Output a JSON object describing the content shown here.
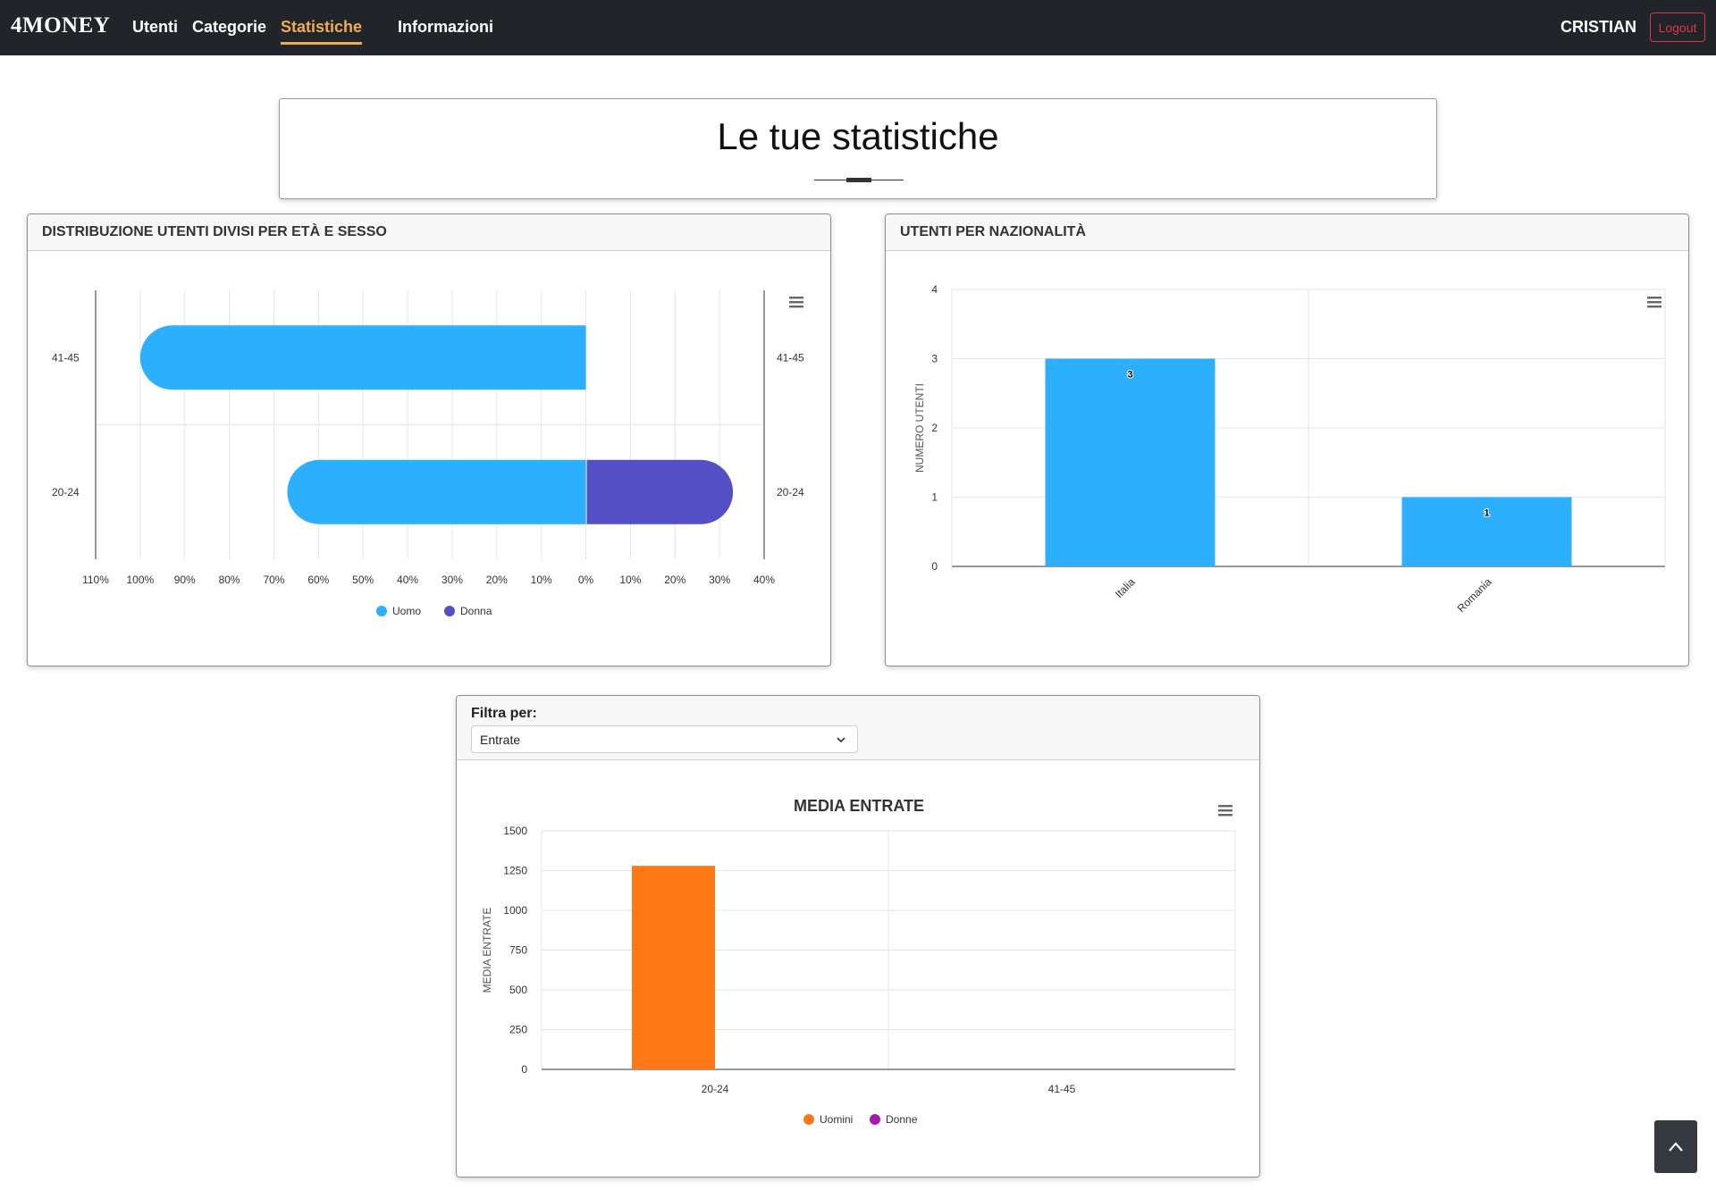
{
  "navbar": {
    "brand": "4MONEY",
    "links": [
      {
        "label": "Utenti",
        "active": false
      },
      {
        "label": "Categorie",
        "active": false
      },
      {
        "label": "Statistiche",
        "active": true
      },
      {
        "label": "Informazioni",
        "active": false
      }
    ],
    "user": "CRISTIAN",
    "logout_label": "Logout"
  },
  "page": {
    "title": "Le tue statistiche"
  },
  "cards": {
    "pyramid_title": "DISTRIBUZIONE UTENTI DIVISI PER ETÀ E SESSO",
    "nation_title": "UTENTI PER NAZIONALITÀ",
    "filter_label": "Filtra per:",
    "filter_value": "Entrate"
  },
  "chart_data": [
    {
      "type": "bar",
      "orientation": "horizontal-diverging",
      "categories": [
        "41-45",
        "20-24"
      ],
      "series": [
        {
          "name": "Uomo",
          "color": "#2caffe",
          "values": [
            -100,
            -67
          ]
        },
        {
          "name": "Donna",
          "color": "#544fc5",
          "values": [
            0,
            33
          ]
        }
      ],
      "x_ticks": [
        "110%",
        "100%",
        "90%",
        "80%",
        "70%",
        "60%",
        "50%",
        "40%",
        "30%",
        "20%",
        "10%",
        "0%",
        "10%",
        "20%",
        "30%",
        "40%"
      ],
      "xlim": [
        -110,
        40
      ],
      "legend": "bottom-center",
      "grid": true
    },
    {
      "type": "bar",
      "categories": [
        "Italia",
        "Romania"
      ],
      "values": [
        3,
        1
      ],
      "color": "#2caffe",
      "ylabel": "NUMERO UTENTI",
      "ylim": [
        0,
        4
      ],
      "y_ticks": [
        "0",
        "1",
        "2",
        "3",
        "4"
      ],
      "data_labels": [
        "3",
        "1"
      ],
      "grid": true
    },
    {
      "type": "bar",
      "title": "MEDIA ENTRATE",
      "ylabel": "MEDIA ENTRATE",
      "categories": [
        "20-24",
        "41-45"
      ],
      "series": [
        {
          "name": "Uomini",
          "color": "#fe7815",
          "values": [
            1280,
            0
          ]
        },
        {
          "name": "Donne",
          "color": "#a81cad",
          "values": [
            0,
            0
          ]
        }
      ],
      "ylim": [
        0,
        1500
      ],
      "y_ticks": [
        "0",
        "250",
        "500",
        "750",
        "1000",
        "1250",
        "1500"
      ],
      "legend": "bottom-center",
      "grid": true
    }
  ]
}
